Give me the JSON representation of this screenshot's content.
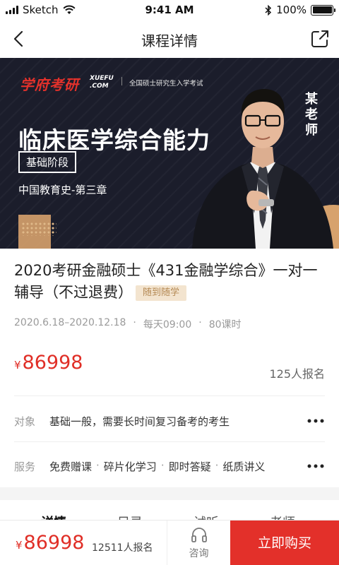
{
  "status_bar": {
    "carrier": "Sketch",
    "time": "9:41 AM",
    "battery": "100%",
    "battery_level": 1.0
  },
  "nav": {
    "title": "课程详情",
    "back_icon": "chevron-left-icon",
    "share_icon": "share-icon"
  },
  "banner": {
    "logo": "学府考研",
    "logo_en_line1": "XUEFU",
    "logo_en_line2": ".COM",
    "tagline": "全国硕士研究生入学考试",
    "headline": "临床医学综合能力",
    "stage": "基础阶段",
    "chapter": "中国教育史-第三章",
    "teacher": "某老师"
  },
  "course": {
    "title": "2020考研金融硕士《431金融学综合》一对一辅导（不过退费）",
    "tag": "随到随学",
    "dates": "2020.6.18–2020.12.18",
    "schedule": "每天09:00",
    "hours": "80课时",
    "price_symbol": "¥",
    "price": "86998",
    "enrolled": "125人报名"
  },
  "info": {
    "target_label": "对象",
    "target_value": "基础一般，需要长时间复习备考的考生",
    "service_label": "服务",
    "services": [
      "免费赠课",
      "碎片化学习",
      "即时答疑",
      "纸质讲义"
    ]
  },
  "tabs": [
    "详情",
    "目录",
    "试听",
    "老师"
  ],
  "bottom_bar": {
    "price_symbol": "¥",
    "price": "86998",
    "count": "12511人报名",
    "consult": "咨询",
    "buy": "立即购买"
  },
  "colors": {
    "accent": "#e3302a",
    "tag_bg": "#f3e4cf",
    "tag_text": "#b58a55",
    "banner_bg": "#1b1d2b"
  }
}
